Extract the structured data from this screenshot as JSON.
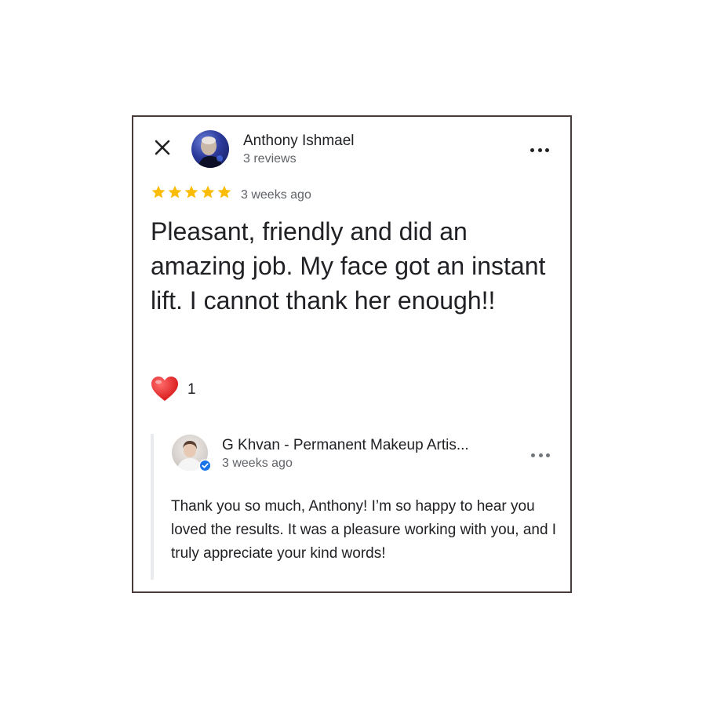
{
  "reviewer": {
    "name": "Anthony Ishmael",
    "reviews_count": "3 reviews"
  },
  "review": {
    "rating": 5,
    "time": "3 weeks ago",
    "text": "Pleasant, friendly and did an amazing job. My face got an instant lift. I cannot thank her enough!!",
    "likes": "1"
  },
  "reply": {
    "owner_name": "G Khvan - Permanent Makeup Artis...",
    "time": "3 weeks ago",
    "text": "Thank you so much, Anthony! I’m so happy to hear you loved the results. It was a pleasure working with you, and I truly appreciate your kind words!"
  },
  "colors": {
    "star": "#fbbc04",
    "heart": "#e53935",
    "verified": "#1a73e8",
    "frame_border": "#4a3b3b"
  },
  "icons": {
    "close": "close-icon",
    "more": "more-horiz-icon",
    "star": "star-icon",
    "reaction": "heart-icon",
    "verified": "verified-check-icon"
  }
}
